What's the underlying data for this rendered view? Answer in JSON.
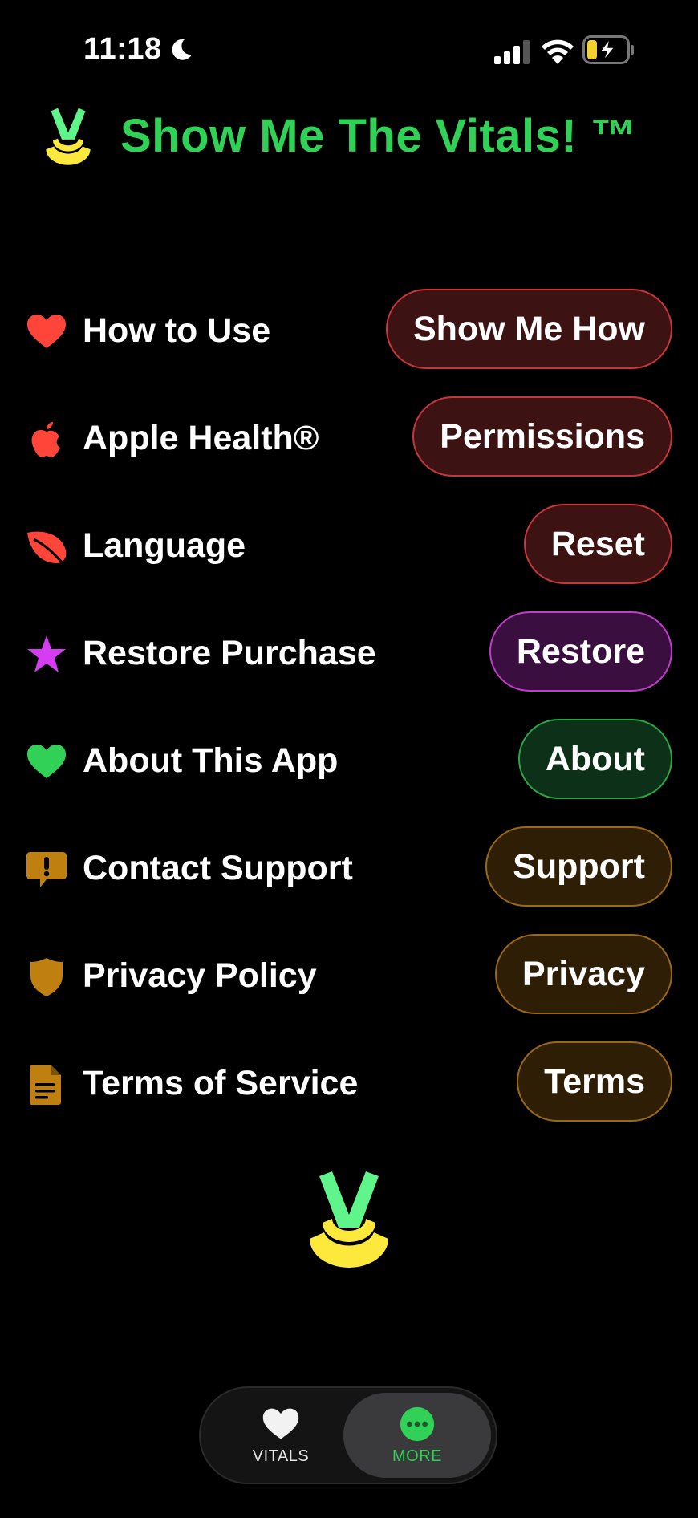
{
  "status_bar": {
    "time": "11:18",
    "moon_icon": "moon-icon",
    "signal_icon": "cellular-signal-icon",
    "wifi_icon": "wifi-icon",
    "battery_icon": "battery-charging-icon"
  },
  "header": {
    "title": "Show Me The Vitals! ™",
    "logo_icon": "vitals-logo-icon"
  },
  "colors": {
    "title_green": "#31d158",
    "red_accent": "#ff453a",
    "purple_accent": "#d43ef0",
    "green_accent": "#31d158",
    "amber_accent": "#c0800f",
    "logo_yellow": "#fde93b",
    "logo_green": "#5ff58a"
  },
  "rows": [
    {
      "label": "How to Use",
      "button": "Show Me How",
      "icon": "heart-icon",
      "tone": "red"
    },
    {
      "label": "Apple Health®",
      "button": "Permissions",
      "icon": "apple-icon",
      "tone": "red"
    },
    {
      "label": "Language",
      "button": "Reset",
      "icon": "leaf-icon",
      "tone": "red"
    },
    {
      "label": "Restore Purchase",
      "button": "Restore",
      "icon": "star-icon",
      "tone": "purple"
    },
    {
      "label": "About This App",
      "button": "About",
      "icon": "heart-icon",
      "tone": "green"
    },
    {
      "label": "Contact Support",
      "button": "Support",
      "icon": "exclamation-bubble-icon",
      "tone": "amber"
    },
    {
      "label": "Privacy Policy",
      "button": "Privacy",
      "icon": "shield-icon",
      "tone": "amber"
    },
    {
      "label": "Terms of Service",
      "button": "Terms",
      "icon": "document-icon",
      "tone": "amber"
    }
  ],
  "tab_bar": {
    "tabs": [
      {
        "label": "VITALS",
        "icon": "heart-icon",
        "selected": false
      },
      {
        "label": "MORE",
        "icon": "ellipsis-circle-icon",
        "selected": true
      }
    ]
  }
}
